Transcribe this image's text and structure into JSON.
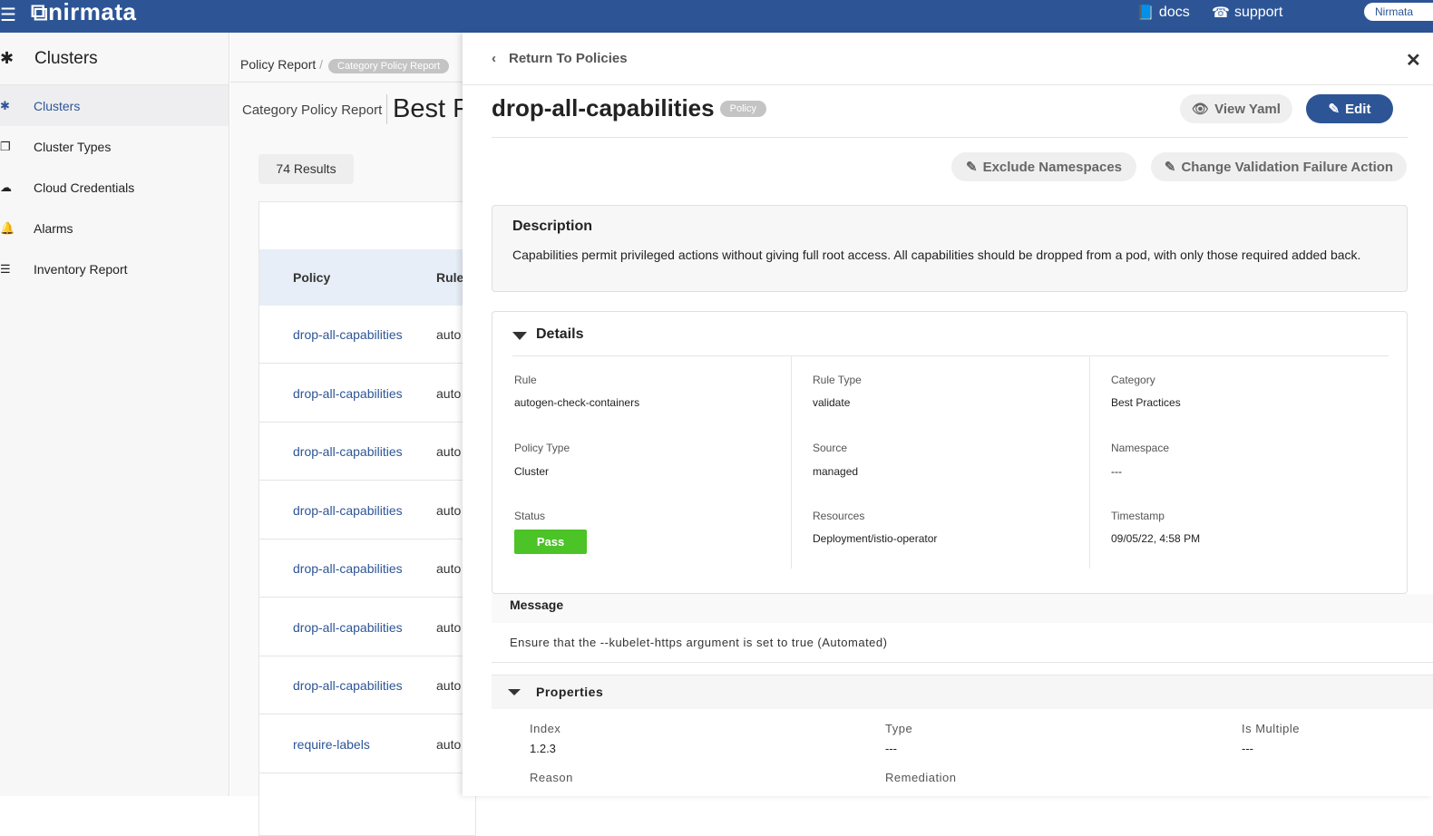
{
  "topbar": {
    "brand": "nirmata",
    "docs": "docs",
    "support": "support",
    "org": "Nirmata"
  },
  "sidebar": {
    "header": "Clusters",
    "items": [
      {
        "label": "Clusters",
        "icon": "clusters-icon",
        "active": true
      },
      {
        "label": "Cluster Types",
        "icon": "copy-icon"
      },
      {
        "label": "Cloud Credentials",
        "icon": "cloud-icon"
      },
      {
        "label": "Alarms",
        "icon": "bell-icon"
      },
      {
        "label": "Inventory Report",
        "icon": "list-icon"
      }
    ]
  },
  "middle": {
    "breadcrumb_root": "Policy Report",
    "breadcrumb_sep": "/",
    "breadcrumb_current": "Category Policy Report",
    "subtitle": "Category Policy Report",
    "heading": "Best P",
    "results": "74 Results",
    "columns": [
      "Policy",
      "Rule"
    ],
    "rows": [
      {
        "policy": "drop-all-capabilities",
        "rule": "auto"
      },
      {
        "policy": "drop-all-capabilities",
        "rule": "auto"
      },
      {
        "policy": "drop-all-capabilities",
        "rule": "auto"
      },
      {
        "policy": "drop-all-capabilities",
        "rule": "auto"
      },
      {
        "policy": "drop-all-capabilities",
        "rule": "auto"
      },
      {
        "policy": "drop-all-capabilities",
        "rule": "auto"
      },
      {
        "policy": "drop-all-capabilities",
        "rule": "auto"
      },
      {
        "policy": "require-labels",
        "rule": "auto"
      }
    ]
  },
  "panel": {
    "return": "Return To Policies",
    "title": "drop-all-capabilities",
    "badge": "Policy",
    "view_yaml": "View Yaml",
    "edit": "Edit",
    "exclude_ns": "Exclude Namespaces",
    "change_action": "Change Validation Failure Action",
    "description": {
      "heading": "Description",
      "text": "Capabilities permit privileged actions without giving full root access. All capabilities should be dropped from a pod, with only those required added back."
    },
    "details": {
      "heading": "Details",
      "rule_label": "Rule",
      "rule": "autogen-check-containers",
      "rule_type_label": "Rule Type",
      "rule_type": "validate",
      "category_label": "Category",
      "category": "Best Practices",
      "policy_type_label": "Policy Type",
      "policy_type": "Cluster",
      "source_label": "Source",
      "source": "managed",
      "namespace_label": "Namespace",
      "namespace": "---",
      "status_label": "Status",
      "status": "Pass",
      "resources_label": "Resources",
      "resources": "Deployment/istio-operator",
      "timestamp_label": "Timestamp",
      "timestamp": "09/05/22, 4:58 PM"
    },
    "message": {
      "heading": "Message",
      "text": "Ensure that the --kubelet-https argument is set to true (Automated)"
    },
    "properties": {
      "heading": "Properties",
      "index_label": "Index",
      "index": "1.2.3",
      "type_label": "Type",
      "type": "---",
      "multiple_label": "Is Multiple",
      "multiple": "---",
      "reason_label": "Reason",
      "remediation_label": "Remediation"
    }
  },
  "colors": {
    "brand": "#2d5596",
    "pass": "#4cc326"
  }
}
